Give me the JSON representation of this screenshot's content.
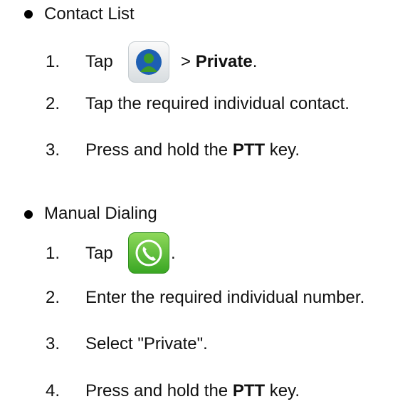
{
  "sections": [
    {
      "title": "Contact List",
      "steps": [
        {
          "num": "1.",
          "pre": "Tap",
          "icon": "contacts-app-icon",
          "post_prefix": " > ",
          "post_bold": "Private",
          "post_suffix": "."
        },
        {
          "num": "2.",
          "text": "Tap the required individual contact."
        },
        {
          "num": "3.",
          "pre": "Press and hold the ",
          "bold": "PTT",
          "post": " key."
        }
      ]
    },
    {
      "title": "Manual Dialing",
      "steps": [
        {
          "num": "1.",
          "pre": "Tap",
          "icon": "phone-app-icon",
          "post": "."
        },
        {
          "num": "2.",
          "text": "Enter the required individual number."
        },
        {
          "num": "3.",
          "text": "Select \"Private\"."
        },
        {
          "num": "4.",
          "pre": "Press and hold the ",
          "bold": "PTT",
          "post": " key."
        }
      ]
    }
  ],
  "colors": {
    "contacts_person": "#3d9a2a",
    "contacts_bg": "#1d5fb3",
    "phone_bg": "#49b52c"
  }
}
